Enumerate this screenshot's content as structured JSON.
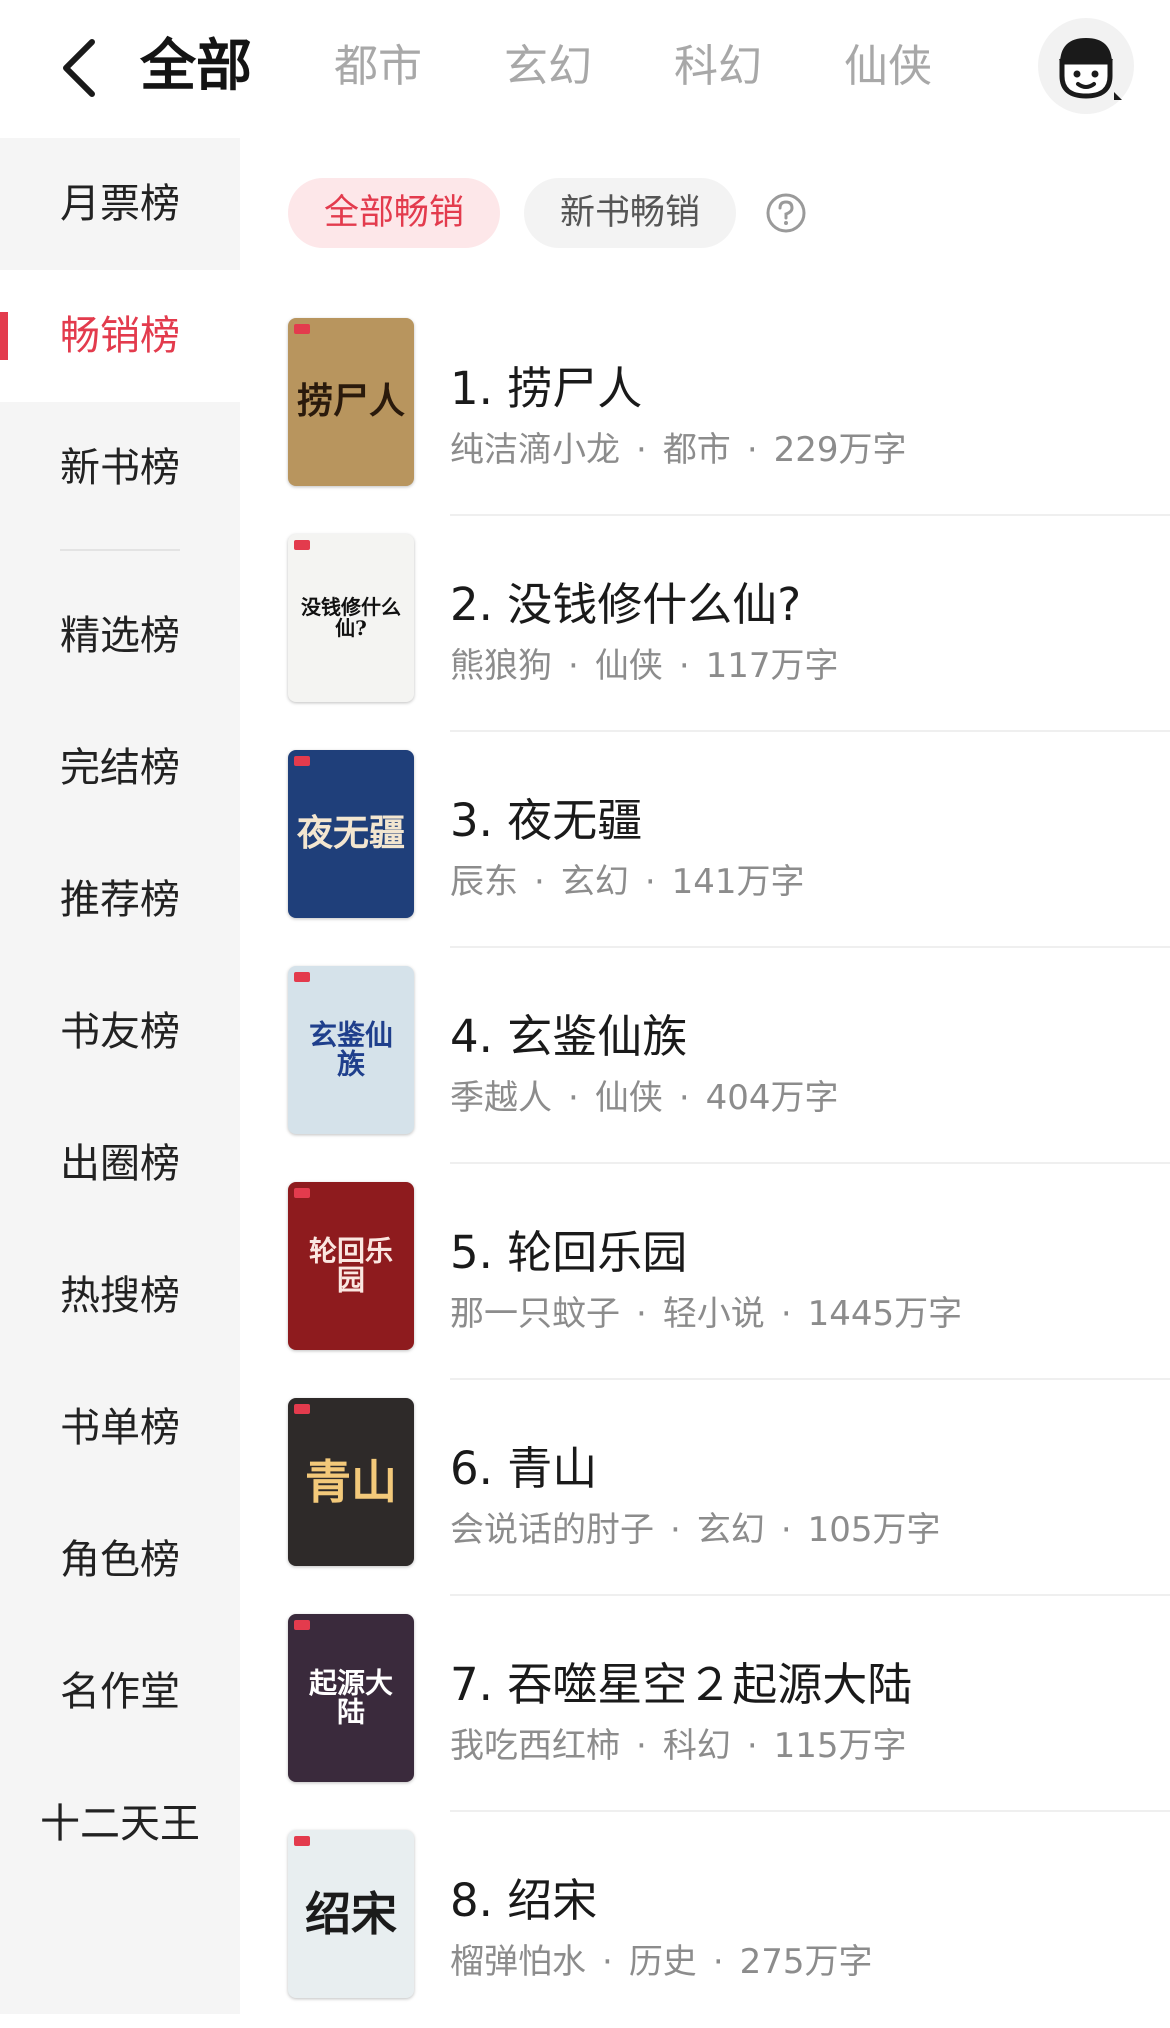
{
  "header": {
    "tabs": [
      "全部",
      "都市",
      "玄幻",
      "科幻",
      "仙侠"
    ],
    "active_tab": 0
  },
  "sidebar": {
    "items": [
      "月票榜",
      "畅销榜",
      "新书榜",
      "精选榜",
      "完结榜",
      "推荐榜",
      "书友榜",
      "出圈榜",
      "热搜榜",
      "书单榜",
      "角色榜",
      "名作堂",
      "十二天王"
    ],
    "active_index": 1
  },
  "filters": {
    "chips": [
      "全部畅销",
      "新书畅销"
    ],
    "active_index": 0
  },
  "books": [
    {
      "title": "1. 捞尸人",
      "author": "纯洁滴小龙",
      "genre": "都市",
      "words": "229万字",
      "cover_text": "捞尸人",
      "cover_bg": "#b8955e",
      "cover_fg": "#2a1a0c"
    },
    {
      "title": "2. 没钱修什么仙?",
      "author": "熊狼狗",
      "genre": "仙侠",
      "words": "117万字",
      "cover_text": "没钱修什么仙?",
      "cover_bg": "#f4f4f2",
      "cover_fg": "#111111"
    },
    {
      "title": "3. 夜无疆",
      "author": "辰东",
      "genre": "玄幻",
      "words": "141万字",
      "cover_text": "夜无疆",
      "cover_bg": "#1f3f7a",
      "cover_fg": "#f3e6d0"
    },
    {
      "title": "4. 玄鉴仙族",
      "author": "季越人",
      "genre": "仙侠",
      "words": "404万字",
      "cover_text": "玄鉴仙族",
      "cover_bg": "#d5e2ea",
      "cover_fg": "#1f3f8c"
    },
    {
      "title": "5. 轮回乐园",
      "author": "那一只蚊子",
      "genre": "轻小说",
      "words": "1445万字",
      "cover_text": "轮回乐园",
      "cover_bg": "#8e1b1e",
      "cover_fg": "#fbe7e1"
    },
    {
      "title": "6. 青山",
      "author": "会说话的肘子",
      "genre": "玄幻",
      "words": "105万字",
      "cover_text": "青山",
      "cover_bg": "#2e2a29",
      "cover_fg": "#f3c97a"
    },
    {
      "title": "7. 吞噬星空２起源大陆",
      "author": "我吃西红柿",
      "genre": "科幻",
      "words": "115万字",
      "cover_text": "起源大陆",
      "cover_bg": "#3a2a3c",
      "cover_fg": "#ffffff"
    },
    {
      "title": "8. 绍宋",
      "author": "榴弹怕水",
      "genre": "历史",
      "words": "275万字",
      "cover_text": "绍宋",
      "cover_bg": "#e8eef0",
      "cover_fg": "#1b1b1b"
    }
  ],
  "colors": {
    "accent": "#e33b4d",
    "sidebar_bg": "#f5f5f5",
    "meta_gray": "#8c8c8c"
  },
  "icons": {
    "back": "back-arrow-icon",
    "avatar": "user-avatar-icon",
    "help": "help-circle-icon"
  }
}
